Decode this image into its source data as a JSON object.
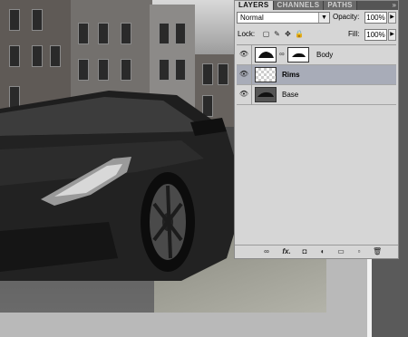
{
  "panel": {
    "tabs": [
      {
        "label": "LAYERS",
        "active": true
      },
      {
        "label": "CHANNELS",
        "active": false
      },
      {
        "label": "PATHS",
        "active": false
      }
    ],
    "menu_icon": "»",
    "blend_mode": "Normal",
    "opacity_label": "Opacity:",
    "opacity_value": "100%",
    "lock_label": "Lock:",
    "fill_label": "Fill:",
    "fill_value": "100%",
    "layers": [
      {
        "name": "Body",
        "selected": false,
        "visible": true,
        "has_mask": true
      },
      {
        "name": "Rims",
        "selected": true,
        "visible": true,
        "has_mask": false
      },
      {
        "name": "Base",
        "selected": false,
        "visible": true,
        "has_mask": false
      }
    ],
    "footer_icons": [
      "link-layers-icon",
      "fx-icon",
      "add-mask-icon",
      "adjustment-layer-icon",
      "group-folder-icon",
      "new-layer-icon",
      "trash-icon"
    ]
  },
  "glyphs": {
    "eye": "👁",
    "chain": "∞",
    "arrow_down": "▼",
    "arrow_right": "▶",
    "fx": "fx.",
    "lock_transparent": "▢",
    "lock_brush": "✎",
    "lock_move": "✥",
    "lock_all": "🔒",
    "link": "∞",
    "mask": "◘",
    "adjust": "◐",
    "folder": "▭",
    "new": "▫",
    "trash": "🗑"
  }
}
